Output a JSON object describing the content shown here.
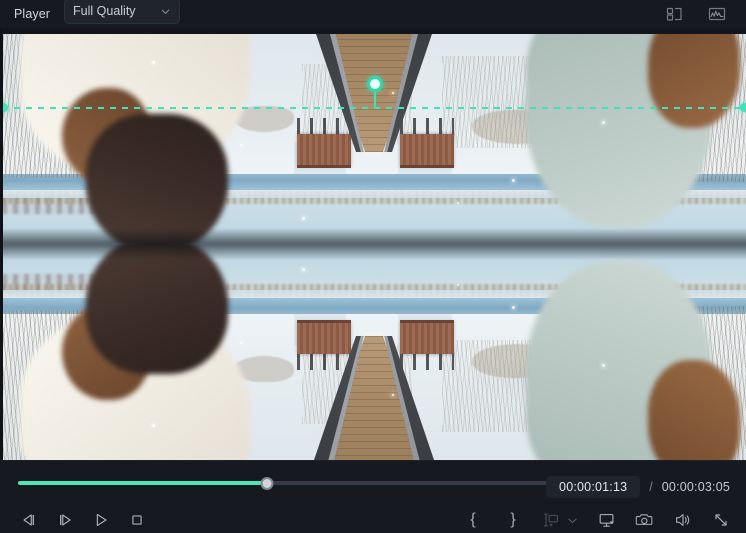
{
  "topbar": {
    "title": "Player",
    "quality": {
      "value": "Full Quality",
      "icon": "chevron-down-icon"
    },
    "icons": [
      {
        "name": "split-view-icon",
        "label": "Split View"
      },
      {
        "name": "waveform-icon",
        "label": "Audio Waveform"
      }
    ]
  },
  "preview": {
    "guide": {
      "color": "#3fe3bb",
      "line_style": "dashed-horizontal",
      "handle": "rotation-handle"
    },
    "effect": "vertical-mirror",
    "scene_description": "Two people in winter clothing on a snowy wooden pier facing a frozen lake"
  },
  "transport": {
    "progress_percent": 47,
    "current_time": "00:00:01:13",
    "time_separator": "/",
    "total_time": "00:00:03:05",
    "buttons": [
      {
        "name": "previous-frame-button",
        "label": "Previous Frame"
      },
      {
        "name": "next-frame-button",
        "label": "Next Frame"
      },
      {
        "name": "play-button",
        "label": "Play"
      },
      {
        "name": "stop-button",
        "label": "Stop"
      }
    ],
    "right_buttons": [
      {
        "name": "mark-in-button",
        "label": "{"
      },
      {
        "name": "mark-out-button",
        "label": "}"
      },
      {
        "name": "split-screen-button",
        "label": "Split Screen Compare"
      },
      {
        "name": "split-screen-dropdown",
        "label": "chevron-down-icon"
      },
      {
        "name": "display-settings-button",
        "label": "Display Settings"
      },
      {
        "name": "snapshot-button",
        "label": "Snapshot"
      },
      {
        "name": "volume-button",
        "label": "Volume"
      },
      {
        "name": "fullscreen-button",
        "label": "Full Screen"
      }
    ]
  },
  "colors": {
    "accent": "#4fe6b4",
    "guide": "#3fe3bb",
    "panel": "#161a20",
    "stage": "#0a0d11",
    "text": "#d3d8de"
  }
}
